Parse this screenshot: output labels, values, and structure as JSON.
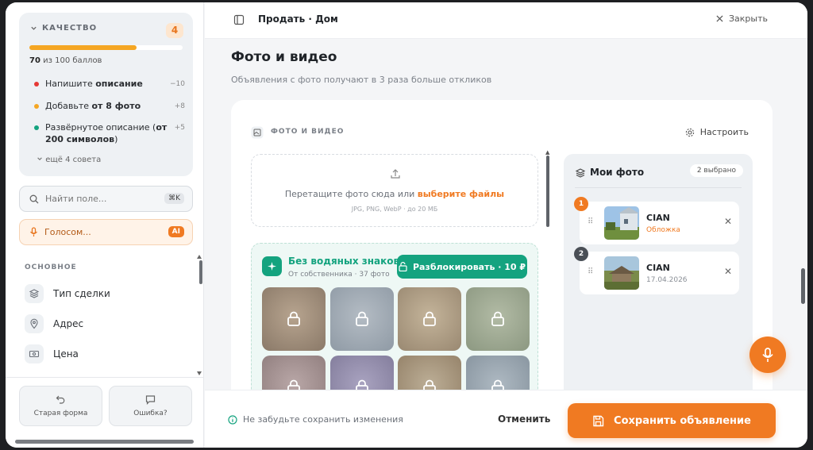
{
  "sidebar": {
    "quality": {
      "title": "КАЧЕСТВО",
      "badge": "4",
      "progress": 0.7,
      "score_value": "70",
      "score_suffix": " из 100 баллов"
    },
    "tips": [
      {
        "prefix": "Напишите ",
        "bold": "описание",
        "suffix": "",
        "points": "−10",
        "color": "#e53935"
      },
      {
        "prefix": "Добавьте ",
        "bold": "от 8 фото",
        "suffix": "",
        "points": "+8",
        "color": "#f5a623"
      },
      {
        "prefix": "Развёрнутое описание (",
        "bold": "от 200 символов",
        "suffix": ")",
        "points": "+5",
        "color": "#14a37f"
      }
    ],
    "more_tips": "ещё 4 совета",
    "search_placeholder": "Найти поле...",
    "search_shortcut": "⌘K",
    "voice_label": "Голосом...",
    "voice_badge": "AI",
    "section_title": "ОСНОВНОЕ",
    "nav": [
      {
        "label": "Тип сделки",
        "icon": "layers-icon"
      },
      {
        "label": "Адрес",
        "icon": "location-pin-icon"
      },
      {
        "label": "Цена",
        "icon": "banknote-icon"
      }
    ],
    "footer": {
      "old_form": "Старая форма",
      "bug": "Ошибка?"
    }
  },
  "header": {
    "title": "Продать · Дом",
    "close_label": "Закрыть"
  },
  "main": {
    "title": "Фото и видео",
    "subtitle": "Объявления с фото получают в 3 раза больше откликов",
    "card_title": "ФОТО И ВИДЕО",
    "settings_label": "Настроить",
    "dropzone": {
      "text": "Перетащите фото сюда или ",
      "link": "выберите файлы",
      "formats": "JPG, PNG, WebP · до 20 МБ"
    },
    "premium": {
      "title": "Без водяных знаков",
      "subtitle": "От собственника · 37 фото",
      "unlock_label": "Разблокировать · 10 ₽"
    },
    "my_photos": {
      "title": "Мои фото",
      "badge": "2 выбрано",
      "items": [
        {
          "num": "1",
          "name": "CIAN",
          "meta": "Обложка",
          "num_color": "#f07a22",
          "meta_color": "#f07a22"
        },
        {
          "num": "2",
          "name": "CIAN",
          "meta": "17.04.2026",
          "num_color": "#4a4f56",
          "meta_color": "#8a8f96"
        }
      ]
    }
  },
  "footer": {
    "hint": "Не забудьте сохранить изменения",
    "cancel_label": "Отменить",
    "save_label": "Сохранить объявление"
  },
  "colors": {
    "accent": "#f07a22",
    "success": "#14a37f"
  }
}
